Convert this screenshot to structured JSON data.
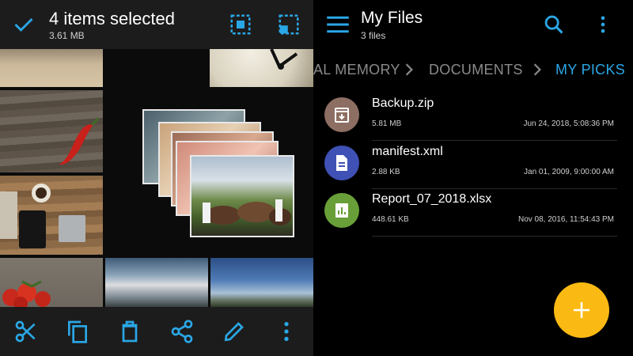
{
  "left_pane": {
    "title": "4 items selected",
    "size": "3.61 MB",
    "toolbar_icons": [
      "select-all-icon",
      "select-inverse-icon"
    ],
    "bottom_actions": [
      "cut-icon",
      "copy-icon",
      "delete-icon",
      "share-icon",
      "edit-icon",
      "more-vert-icon"
    ]
  },
  "right_pane": {
    "title": "My Files",
    "subtitle": "3 files",
    "breadcrumbs": [
      "AL MEMORY",
      "DOCUMENTS",
      "MY PICKS"
    ],
    "files": [
      {
        "name": "Backup.zip",
        "size": "5.81 MB",
        "date": "Jun 24, 2018, 5:08:36 PM",
        "icon": "archive-icon",
        "color": "#8d6e63"
      },
      {
        "name": "manifest.xml",
        "size": "2.88 KB",
        "date": "Jan 01, 2009, 9:00:00 AM",
        "icon": "document-icon",
        "color": "#3f51b5"
      },
      {
        "name": "Report_07_2018.xlsx",
        "size": "448.61 KB",
        "date": "Nov 08, 2016, 11:54:43 PM",
        "icon": "spreadsheet-icon",
        "color": "#689f38"
      }
    ]
  },
  "colors": {
    "accent": "#2aa7e6",
    "fab": "#fbba13",
    "bar": "#1c1c1c"
  }
}
